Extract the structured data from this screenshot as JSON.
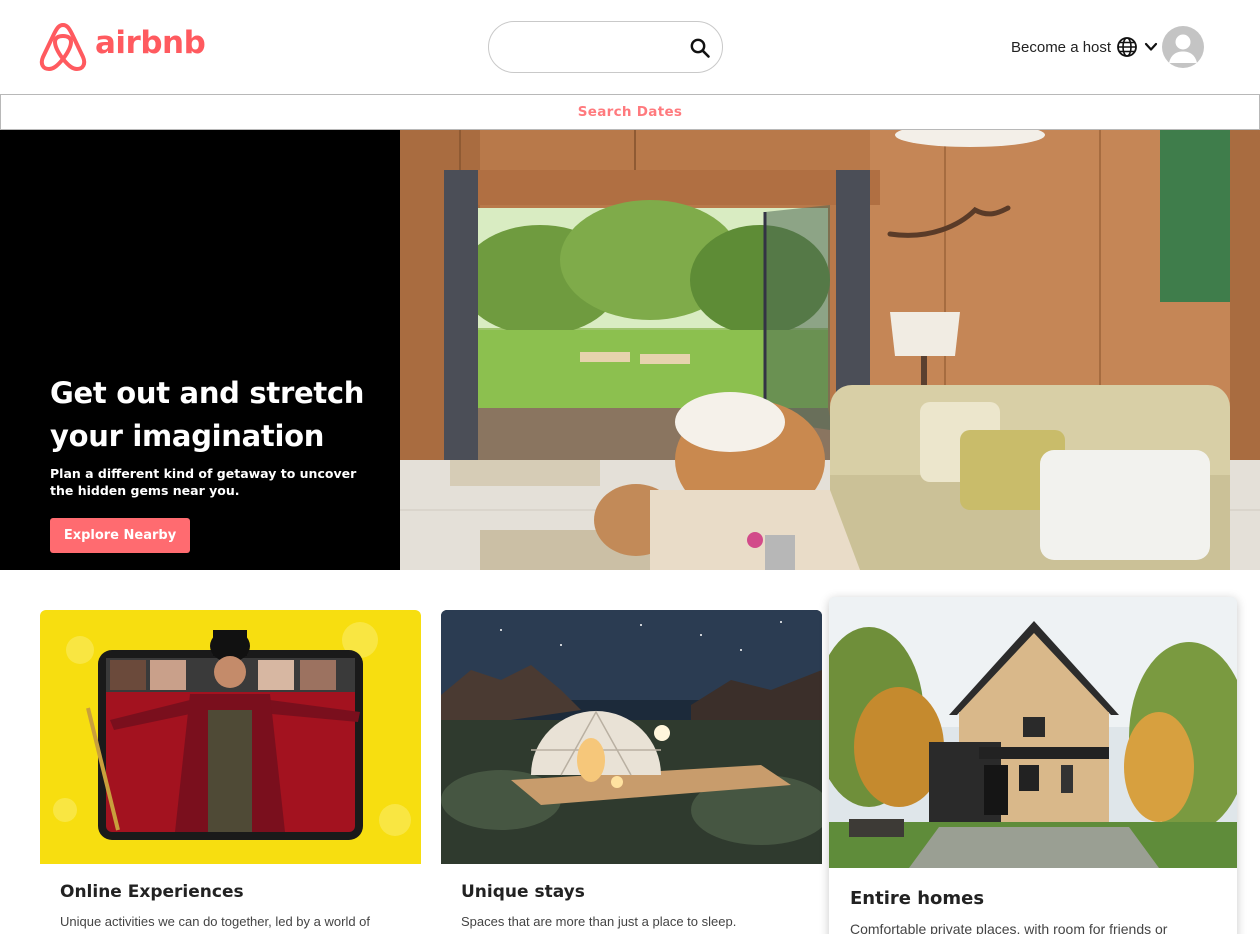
{
  "header": {
    "logo_text": "airbnb",
    "search_placeholder": "",
    "host_label": "Become a host"
  },
  "dates_bar": {
    "label": "Search Dates"
  },
  "hero": {
    "title": "Get out and stretch your imagination",
    "subtitle": "Plan a different kind of getaway to uncover the hidden gems near you.",
    "button_label": "Explore Nearby"
  },
  "cards": [
    {
      "title": "Online Experiences",
      "description": "Unique activities we can do together, led by a world of"
    },
    {
      "title": "Unique stays",
      "description": "Spaces that are more than just a place to sleep."
    },
    {
      "title": "Entire homes",
      "description": "Comfortable private places, with room for friends or"
    }
  ],
  "colors": {
    "brand": "#ff5a5f",
    "button": "#ff6b70",
    "dates_text": "#ff7a7e"
  },
  "icons": [
    "airbnb-logo-icon",
    "search-icon",
    "globe-icon",
    "chevron-down-icon",
    "user-avatar-icon"
  ]
}
